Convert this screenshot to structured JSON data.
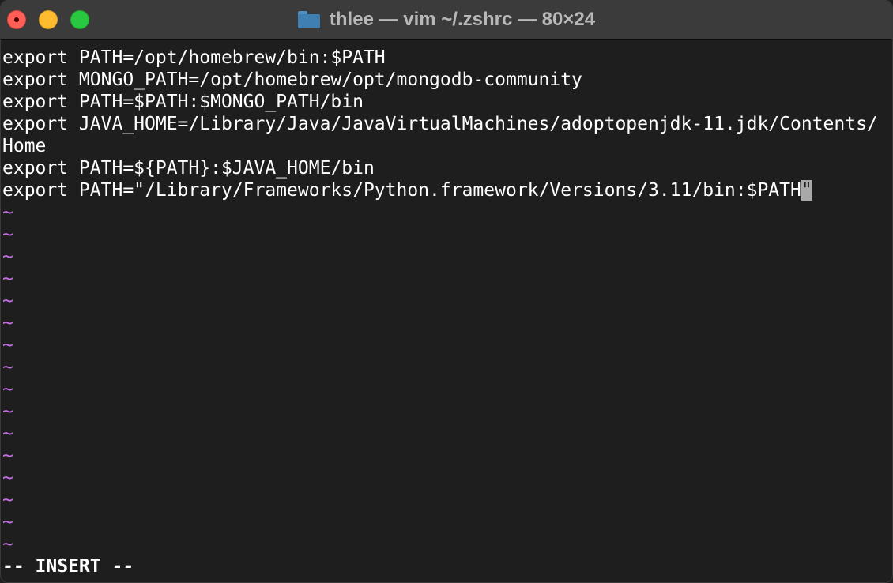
{
  "window": {
    "title": "thlee — vim ~/.zshrc — 80×24",
    "folder_icon": "folder-icon",
    "colors": {
      "titlebar": "#3b3b3b",
      "background": "#1e1e1e",
      "text": "#ffffff",
      "tilde": "#c770e6",
      "close": "#fe5f57",
      "minimize": "#febc2e",
      "zoom": "#28c840"
    }
  },
  "editor": {
    "lines": [
      "export PATH=/opt/homebrew/bin:$PATH",
      "export MONGO_PATH=/opt/homebrew/opt/mongodb-community",
      "export PATH=$PATH:$MONGO_PATH/bin",
      "export JAVA_HOME=/Library/Java/JavaVirtualMachines/adoptopenjdk-11.jdk/Contents/",
      "Home",
      "export PATH=${PATH}:$JAVA_HOME/bin"
    ],
    "cursor_line_before": "export PATH=\"/Library/Frameworks/Python.framework/Versions/3.11/bin:$PATH",
    "cursor_char": "\"",
    "tilde": "~",
    "mode": "-- INSERT --"
  }
}
